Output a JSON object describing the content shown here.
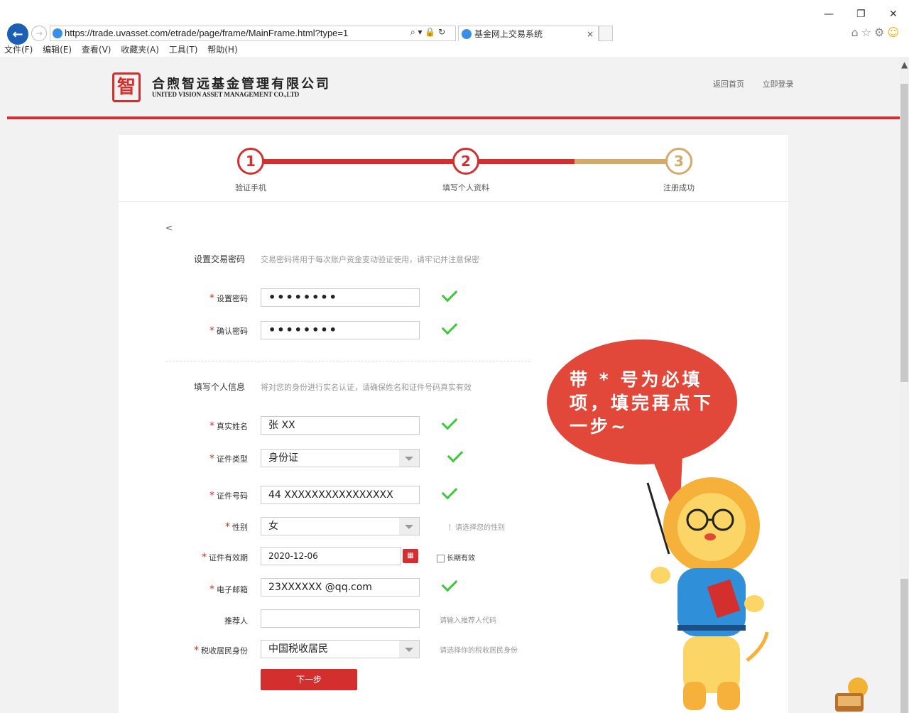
{
  "browser": {
    "url": "https://trade.uvasset.com/etrade/page/frame/MainFrame.html?type=1",
    "tab_title": "基金网上交易系统",
    "tab_close": "×",
    "addr_tools": "⌕ ▾ 🔒 ↻",
    "menu": [
      "文件(F)",
      "编辑(E)",
      "查看(V)",
      "收藏夹(A)",
      "工具(T)",
      "帮助(H)"
    ]
  },
  "header": {
    "logo_mark": "智",
    "company_cn": "合煦智远基金管理有限公司",
    "company_en": "UNITED VISION ASSET MANAGEMENT CO.,LTD",
    "links": [
      "返回首页",
      "立即登录"
    ]
  },
  "steps": [
    {
      "num": "1",
      "label": "验证手机"
    },
    {
      "num": "2",
      "label": "填写个人资料"
    },
    {
      "num": "3",
      "label": "注册成功"
    }
  ],
  "back_label": "<",
  "password_section": {
    "title": "设置交易密码",
    "hint": "交易密码将用于每次账户资金变动验证使用，请牢记并注意保密",
    "set_label": "设置密码",
    "set_value": "••••••••",
    "confirm_label": "确认密码",
    "confirm_value": "••••••••"
  },
  "info_section": {
    "title": "填写个人信息",
    "hint": "将对您的身份进行实名认证，请确保姓名和证件号码真实有效",
    "name_label": "真实姓名",
    "name_value": "张 XX",
    "idtype_label": "证件类型",
    "idtype_value": "身份证",
    "idno_label": "证件号码",
    "idno_value": "44 XXXXXXXXXXXXXXXX",
    "gender_label": "性别",
    "gender_value": "女",
    "gender_hint": "！请选择您的性别",
    "expiry_label": "证件有效期",
    "expiry_value": "2020-12-06",
    "longterm_label": "长期有效",
    "email_label": "电子邮箱",
    "email_value": "23XXXXXX @qq.com",
    "referrer_label": "推荐人",
    "referrer_value": "",
    "referrer_hint": "请输入推荐人代码",
    "tax_label": "税收居民身份",
    "tax_value": "中国税收居民",
    "tax_hint": "请选择你的税收居民身份"
  },
  "next_button": "下一步",
  "bubble_text": "带 * 号为必填项，填完再点下一步~",
  "colors": {
    "brand_red": "#d32f2f",
    "progress_pending": "#d4a96a",
    "check_green": "#3cc93c",
    "bubble_red": "#e2483a"
  }
}
